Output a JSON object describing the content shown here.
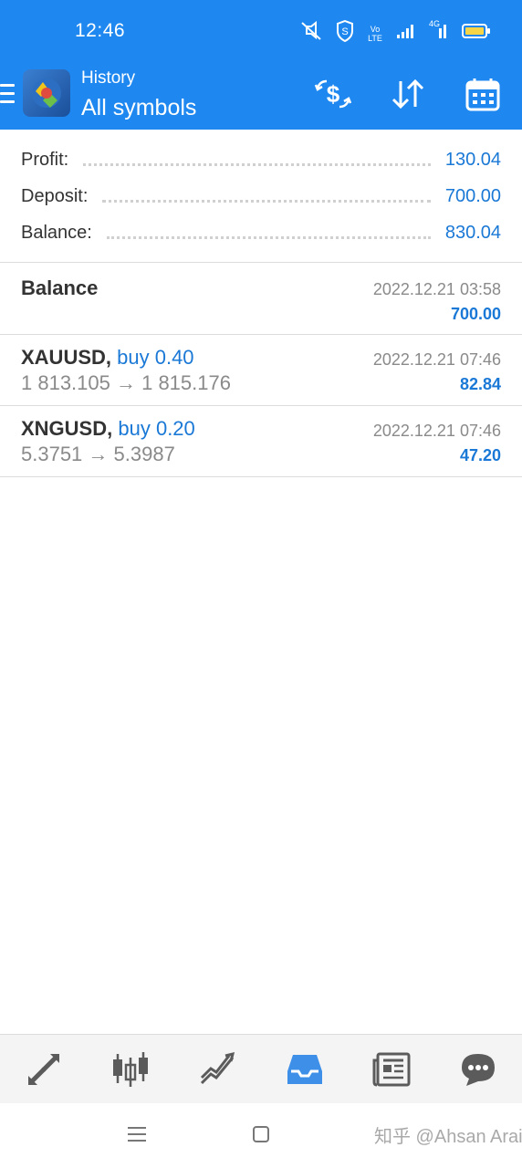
{
  "status_bar": {
    "time": "12:46",
    "icons": [
      "mute-icon",
      "shield-icon",
      "volte-icon",
      "signal-icon",
      "signal-4g-icon",
      "battery-icon"
    ],
    "volte_text": "Vo LTE",
    "network": "4G"
  },
  "header": {
    "subtitle": "History",
    "title": "All symbols",
    "logo": "metatrader-logo",
    "actions": [
      "dollar-exchange-icon",
      "sort-icon",
      "calendar-icon"
    ]
  },
  "summary": {
    "profit_label": "Profit:",
    "profit_value": "130.04",
    "deposit_label": "Deposit:",
    "deposit_value": "700.00",
    "balance_label": "Balance:",
    "balance_value": "830.04"
  },
  "deals": [
    {
      "symbol": "Balance",
      "type": "",
      "prices": "",
      "time": "2022.12.21 03:58",
      "amount": "700.00"
    },
    {
      "symbol": "XAUUSD,",
      "type": "buy 0.40",
      "prices": "1 813.105 → 1 815.176",
      "time": "2022.12.21 07:46",
      "amount": "82.84"
    },
    {
      "symbol": "XNGUSD,",
      "type": "buy 0.20",
      "prices": "5.3751 → 5.3987",
      "time": "2022.12.21 07:46",
      "amount": "47.20"
    }
  ],
  "bottom_nav": {
    "items": [
      "quotes-icon",
      "chart-icon",
      "trade-icon",
      "history-icon",
      "news-icon",
      "messages-icon"
    ],
    "active": "history-icon"
  },
  "watermark": "知乎 @Ahsan Arain",
  "colors": {
    "accent": "#1e88f0",
    "value": "#1a78d6",
    "muted": "#8a8a8a",
    "text": "#333333"
  }
}
